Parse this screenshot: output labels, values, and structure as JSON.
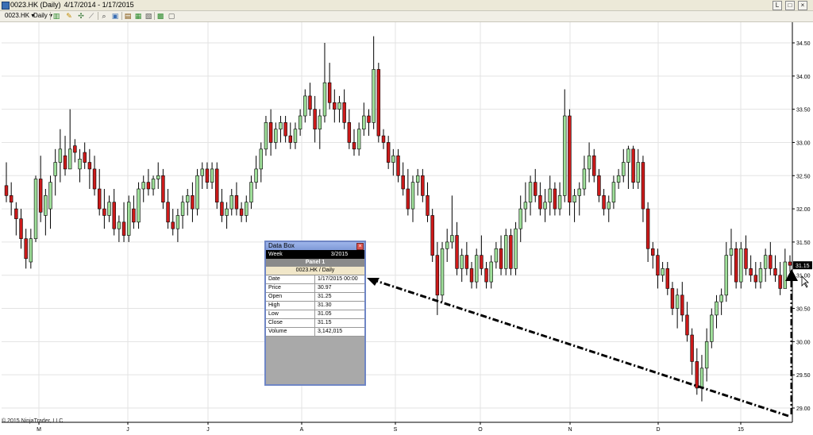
{
  "window": {
    "title_symbol": "0023.HK (Daily)",
    "title_range": "4/17/2014 - 1/17/2015",
    "buttons": [
      "L",
      "□",
      "×"
    ]
  },
  "toolbar": {
    "instrument": "0023.HK",
    "interval": "Daily"
  },
  "colors": {
    "up_candle": "#9fdf9a",
    "down_candle": "#cc1a1a",
    "grid": "#e3e3e3",
    "databox_border": "#6f86c5"
  },
  "chart_data": {
    "type": "candlestick",
    "y_ticks": [
      "34.50",
      "34.00",
      "33.50",
      "33.00",
      "32.50",
      "32.00",
      "31.50",
      "31.00",
      "30.50",
      "30.00",
      "29.50",
      "29.00"
    ],
    "ylim": [
      28.9,
      34.7
    ],
    "x_ticks": [
      "M",
      "J",
      "J",
      "A",
      "S",
      "O",
      "N",
      "D",
      "15"
    ],
    "last_price_label": "31.15",
    "candles": [
      {
        "o": 32.35,
        "h": 32.7,
        "l": 32.1,
        "c": 32.2
      },
      {
        "o": 32.2,
        "h": 32.4,
        "l": 31.9,
        "c": 32.1
      },
      {
        "o": 32.0,
        "h": 32.1,
        "l": 31.6,
        "c": 31.85
      },
      {
        "o": 31.85,
        "h": 32.0,
        "l": 31.4,
        "c": 31.55
      },
      {
        "o": 31.55,
        "h": 31.7,
        "l": 31.1,
        "c": 31.25
      },
      {
        "o": 31.2,
        "h": 31.7,
        "l": 31.1,
        "c": 31.55
      },
      {
        "o": 31.55,
        "h": 32.5,
        "l": 31.5,
        "c": 32.45
      },
      {
        "o": 32.45,
        "h": 32.8,
        "l": 31.8,
        "c": 31.95
      },
      {
        "o": 31.9,
        "h": 32.3,
        "l": 31.6,
        "c": 32.2
      },
      {
        "o": 32.0,
        "h": 32.5,
        "l": 31.7,
        "c": 32.4
      },
      {
        "o": 32.5,
        "h": 32.9,
        "l": 32.2,
        "c": 32.7
      },
      {
        "o": 32.7,
        "h": 33.2,
        "l": 32.4,
        "c": 32.9
      },
      {
        "o": 32.8,
        "h": 33.1,
        "l": 32.5,
        "c": 32.6
      },
      {
        "o": 32.6,
        "h": 33.5,
        "l": 32.6,
        "c": 32.9
      },
      {
        "o": 32.95,
        "h": 33.05,
        "l": 32.7,
        "c": 32.85
      },
      {
        "o": 32.6,
        "h": 32.9,
        "l": 32.4,
        "c": 32.75
      },
      {
        "o": 32.85,
        "h": 33.0,
        "l": 32.6,
        "c": 32.7
      },
      {
        "o": 32.7,
        "h": 32.9,
        "l": 32.3,
        "c": 32.6
      },
      {
        "o": 32.6,
        "h": 32.8,
        "l": 32.2,
        "c": 32.3
      },
      {
        "o": 32.3,
        "h": 32.6,
        "l": 31.9,
        "c": 32.0
      },
      {
        "o": 32.0,
        "h": 32.3,
        "l": 31.7,
        "c": 31.9
      },
      {
        "o": 31.9,
        "h": 32.2,
        "l": 31.8,
        "c": 32.1
      },
      {
        "o": 32.1,
        "h": 32.3,
        "l": 31.6,
        "c": 31.7
      },
      {
        "o": 31.7,
        "h": 31.9,
        "l": 31.5,
        "c": 31.8
      },
      {
        "o": 31.8,
        "h": 32.1,
        "l": 31.5,
        "c": 31.6
      },
      {
        "o": 31.6,
        "h": 32.2,
        "l": 31.5,
        "c": 32.1
      },
      {
        "o": 32.0,
        "h": 32.2,
        "l": 31.7,
        "c": 31.8
      },
      {
        "o": 31.8,
        "h": 32.4,
        "l": 31.7,
        "c": 32.3
      },
      {
        "o": 32.3,
        "h": 32.5,
        "l": 32.1,
        "c": 32.4
      },
      {
        "o": 32.4,
        "h": 32.6,
        "l": 32.2,
        "c": 32.3
      },
      {
        "o": 32.3,
        "h": 32.5,
        "l": 32.2,
        "c": 32.45
      },
      {
        "o": 32.45,
        "h": 32.7,
        "l": 32.3,
        "c": 32.5
      },
      {
        "o": 32.5,
        "h": 32.6,
        "l": 32.0,
        "c": 32.1
      },
      {
        "o": 32.1,
        "h": 32.3,
        "l": 31.7,
        "c": 31.8
      },
      {
        "o": 31.8,
        "h": 32.0,
        "l": 31.6,
        "c": 31.7
      },
      {
        "o": 31.7,
        "h": 32.0,
        "l": 31.5,
        "c": 31.9
      },
      {
        "o": 31.9,
        "h": 32.2,
        "l": 31.7,
        "c": 32.1
      },
      {
        "o": 32.1,
        "h": 32.3,
        "l": 31.9,
        "c": 32.2
      },
      {
        "o": 32.2,
        "h": 32.4,
        "l": 31.8,
        "c": 32.0
      },
      {
        "o": 32.0,
        "h": 32.6,
        "l": 31.9,
        "c": 32.5
      },
      {
        "o": 32.5,
        "h": 32.7,
        "l": 32.3,
        "c": 32.6
      },
      {
        "o": 32.6,
        "h": 32.7,
        "l": 32.3,
        "c": 32.4
      },
      {
        "o": 32.4,
        "h": 32.7,
        "l": 32.3,
        "c": 32.6
      },
      {
        "o": 32.6,
        "h": 32.7,
        "l": 32.0,
        "c": 32.1
      },
      {
        "o": 32.1,
        "h": 32.3,
        "l": 31.8,
        "c": 31.9
      },
      {
        "o": 31.9,
        "h": 32.1,
        "l": 31.7,
        "c": 32.0
      },
      {
        "o": 32.0,
        "h": 32.3,
        "l": 31.9,
        "c": 32.2
      },
      {
        "o": 32.2,
        "h": 32.4,
        "l": 31.9,
        "c": 32.0
      },
      {
        "o": 32.0,
        "h": 32.1,
        "l": 31.8,
        "c": 31.9
      },
      {
        "o": 31.9,
        "h": 32.2,
        "l": 31.8,
        "c": 32.1
      },
      {
        "o": 32.1,
        "h": 32.5,
        "l": 32.0,
        "c": 32.4
      },
      {
        "o": 32.4,
        "h": 32.8,
        "l": 32.3,
        "c": 32.6
      },
      {
        "o": 32.6,
        "h": 33.0,
        "l": 32.4,
        "c": 32.9
      },
      {
        "o": 32.9,
        "h": 33.4,
        "l": 32.8,
        "c": 33.3
      },
      {
        "o": 33.3,
        "h": 33.5,
        "l": 32.8,
        "c": 33.0
      },
      {
        "o": 33.0,
        "h": 33.3,
        "l": 32.9,
        "c": 33.2
      },
      {
        "o": 33.2,
        "h": 33.4,
        "l": 33.0,
        "c": 33.3
      },
      {
        "o": 33.3,
        "h": 33.4,
        "l": 33.0,
        "c": 33.1
      },
      {
        "o": 33.1,
        "h": 33.3,
        "l": 32.9,
        "c": 33.0
      },
      {
        "o": 33.0,
        "h": 33.3,
        "l": 32.9,
        "c": 33.2
      },
      {
        "o": 33.2,
        "h": 33.5,
        "l": 33.1,
        "c": 33.4
      },
      {
        "o": 33.4,
        "h": 33.8,
        "l": 33.3,
        "c": 33.7
      },
      {
        "o": 33.7,
        "h": 33.9,
        "l": 33.4,
        "c": 33.5
      },
      {
        "o": 33.5,
        "h": 33.7,
        "l": 33.0,
        "c": 33.2
      },
      {
        "o": 33.2,
        "h": 33.5,
        "l": 32.9,
        "c": 33.4
      },
      {
        "o": 33.4,
        "h": 34.5,
        "l": 33.3,
        "c": 33.9
      },
      {
        "o": 33.9,
        "h": 34.2,
        "l": 33.5,
        "c": 33.6
      },
      {
        "o": 33.6,
        "h": 33.8,
        "l": 33.3,
        "c": 33.5
      },
      {
        "o": 33.5,
        "h": 33.7,
        "l": 33.3,
        "c": 33.6
      },
      {
        "o": 33.6,
        "h": 33.8,
        "l": 33.2,
        "c": 33.3
      },
      {
        "o": 33.3,
        "h": 33.5,
        "l": 32.9,
        "c": 33.0
      },
      {
        "o": 33.0,
        "h": 33.2,
        "l": 32.8,
        "c": 32.9
      },
      {
        "o": 32.9,
        "h": 33.3,
        "l": 32.8,
        "c": 33.2
      },
      {
        "o": 33.2,
        "h": 33.6,
        "l": 33.1,
        "c": 33.4
      },
      {
        "o": 33.4,
        "h": 33.5,
        "l": 33.1,
        "c": 33.3
      },
      {
        "o": 33.3,
        "h": 34.6,
        "l": 33.2,
        "c": 34.1
      },
      {
        "o": 34.1,
        "h": 34.2,
        "l": 33.0,
        "c": 33.1
      },
      {
        "o": 33.1,
        "h": 33.2,
        "l": 32.9,
        "c": 33.0
      },
      {
        "o": 33.0,
        "h": 33.1,
        "l": 32.6,
        "c": 32.7
      },
      {
        "o": 32.7,
        "h": 32.9,
        "l": 32.5,
        "c": 32.8
      },
      {
        "o": 32.8,
        "h": 32.9,
        "l": 32.4,
        "c": 32.5
      },
      {
        "o": 32.5,
        "h": 32.7,
        "l": 32.2,
        "c": 32.3
      },
      {
        "o": 32.3,
        "h": 32.6,
        "l": 31.9,
        "c": 32.0
      },
      {
        "o": 32.0,
        "h": 32.5,
        "l": 31.8,
        "c": 32.4
      },
      {
        "o": 32.4,
        "h": 32.6,
        "l": 32.2,
        "c": 32.5
      },
      {
        "o": 32.5,
        "h": 32.6,
        "l": 32.1,
        "c": 32.2
      },
      {
        "o": 32.2,
        "h": 32.4,
        "l": 31.8,
        "c": 31.9
      },
      {
        "o": 31.9,
        "h": 32.0,
        "l": 31.2,
        "c": 31.3
      },
      {
        "o": 31.3,
        "h": 31.5,
        "l": 30.4,
        "c": 30.7
      },
      {
        "o": 30.7,
        "h": 31.5,
        "l": 30.6,
        "c": 31.4
      },
      {
        "o": 31.4,
        "h": 31.7,
        "l": 31.2,
        "c": 31.5
      },
      {
        "o": 31.5,
        "h": 32.2,
        "l": 31.4,
        "c": 31.6
      },
      {
        "o": 31.6,
        "h": 31.8,
        "l": 31.0,
        "c": 31.1
      },
      {
        "o": 31.1,
        "h": 31.4,
        "l": 30.9,
        "c": 31.3
      },
      {
        "o": 31.3,
        "h": 31.5,
        "l": 31.0,
        "c": 31.1
      },
      {
        "o": 31.1,
        "h": 31.2,
        "l": 30.8,
        "c": 30.9
      },
      {
        "o": 30.9,
        "h": 31.4,
        "l": 30.8,
        "c": 31.3
      },
      {
        "o": 31.3,
        "h": 31.6,
        "l": 31.0,
        "c": 31.1
      },
      {
        "o": 31.1,
        "h": 31.2,
        "l": 30.8,
        "c": 30.9
      },
      {
        "o": 30.9,
        "h": 31.3,
        "l": 30.8,
        "c": 31.2
      },
      {
        "o": 31.2,
        "h": 31.5,
        "l": 31.1,
        "c": 31.4
      },
      {
        "o": 31.4,
        "h": 31.6,
        "l": 31.0,
        "c": 31.1
      },
      {
        "o": 31.1,
        "h": 31.7,
        "l": 31.0,
        "c": 31.6
      },
      {
        "o": 31.6,
        "h": 31.7,
        "l": 31.0,
        "c": 31.1
      },
      {
        "o": 31.1,
        "h": 31.8,
        "l": 31.0,
        "c": 31.7
      },
      {
        "o": 31.7,
        "h": 32.2,
        "l": 31.5,
        "c": 32.0
      },
      {
        "o": 32.0,
        "h": 32.4,
        "l": 31.8,
        "c": 32.1
      },
      {
        "o": 32.1,
        "h": 32.5,
        "l": 31.9,
        "c": 32.4
      },
      {
        "o": 32.4,
        "h": 32.6,
        "l": 32.1,
        "c": 32.2
      },
      {
        "o": 32.2,
        "h": 32.4,
        "l": 31.9,
        "c": 32.0
      },
      {
        "o": 32.0,
        "h": 32.3,
        "l": 31.8,
        "c": 32.1
      },
      {
        "o": 32.1,
        "h": 32.5,
        "l": 31.9,
        "c": 32.3
      },
      {
        "o": 32.3,
        "h": 32.4,
        "l": 31.9,
        "c": 32.0
      },
      {
        "o": 32.0,
        "h": 32.4,
        "l": 31.9,
        "c": 32.2
      },
      {
        "o": 32.2,
        "h": 33.8,
        "l": 32.1,
        "c": 33.4
      },
      {
        "o": 33.4,
        "h": 33.5,
        "l": 31.9,
        "c": 32.1
      },
      {
        "o": 32.1,
        "h": 32.3,
        "l": 31.8,
        "c": 32.2
      },
      {
        "o": 32.2,
        "h": 32.4,
        "l": 31.9,
        "c": 32.3
      },
      {
        "o": 32.3,
        "h": 32.8,
        "l": 32.2,
        "c": 32.6
      },
      {
        "o": 32.6,
        "h": 33.0,
        "l": 32.4,
        "c": 32.8
      },
      {
        "o": 32.8,
        "h": 32.9,
        "l": 32.4,
        "c": 32.5
      },
      {
        "o": 32.5,
        "h": 32.6,
        "l": 32.1,
        "c": 32.2
      },
      {
        "o": 32.2,
        "h": 32.3,
        "l": 31.9,
        "c": 32.0
      },
      {
        "o": 32.0,
        "h": 32.2,
        "l": 31.8,
        "c": 32.1
      },
      {
        "o": 32.1,
        "h": 32.5,
        "l": 32.0,
        "c": 32.4
      },
      {
        "o": 32.4,
        "h": 32.6,
        "l": 32.3,
        "c": 32.5
      },
      {
        "o": 32.5,
        "h": 32.9,
        "l": 32.4,
        "c": 32.7
      },
      {
        "o": 32.7,
        "h": 32.95,
        "l": 32.3,
        "c": 32.9
      },
      {
        "o": 32.9,
        "h": 32.95,
        "l": 32.3,
        "c": 32.4
      },
      {
        "o": 32.4,
        "h": 32.9,
        "l": 32.3,
        "c": 32.7
      },
      {
        "o": 32.7,
        "h": 32.8,
        "l": 31.8,
        "c": 32.0
      },
      {
        "o": 32.0,
        "h": 32.1,
        "l": 31.2,
        "c": 31.4
      },
      {
        "o": 31.4,
        "h": 31.5,
        "l": 31.1,
        "c": 31.3
      },
      {
        "o": 31.3,
        "h": 31.4,
        "l": 30.8,
        "c": 31.0
      },
      {
        "o": 31.0,
        "h": 31.2,
        "l": 30.9,
        "c": 31.1
      },
      {
        "o": 31.1,
        "h": 31.2,
        "l": 30.7,
        "c": 30.8
      },
      {
        "o": 30.8,
        "h": 30.9,
        "l": 30.4,
        "c": 30.5
      },
      {
        "o": 30.5,
        "h": 30.8,
        "l": 30.2,
        "c": 30.7
      },
      {
        "o": 30.7,
        "h": 30.9,
        "l": 30.3,
        "c": 30.4
      },
      {
        "o": 30.4,
        "h": 30.6,
        "l": 30.0,
        "c": 30.1
      },
      {
        "o": 30.1,
        "h": 30.2,
        "l": 29.5,
        "c": 29.7
      },
      {
        "o": 29.7,
        "h": 29.9,
        "l": 29.2,
        "c": 29.3
      },
      {
        "o": 29.3,
        "h": 29.8,
        "l": 29.1,
        "c": 29.6
      },
      {
        "o": 29.6,
        "h": 30.2,
        "l": 29.4,
        "c": 30.0
      },
      {
        "o": 30.0,
        "h": 30.5,
        "l": 29.9,
        "c": 30.4
      },
      {
        "o": 30.4,
        "h": 30.7,
        "l": 30.2,
        "c": 30.6
      },
      {
        "o": 30.6,
        "h": 30.8,
        "l": 30.4,
        "c": 30.7
      },
      {
        "o": 30.7,
        "h": 31.5,
        "l": 30.6,
        "c": 31.3
      },
      {
        "o": 31.3,
        "h": 31.7,
        "l": 31.0,
        "c": 31.4
      },
      {
        "o": 31.4,
        "h": 31.5,
        "l": 30.8,
        "c": 30.9
      },
      {
        "o": 30.9,
        "h": 31.5,
        "l": 30.8,
        "c": 31.4
      },
      {
        "o": 31.4,
        "h": 31.6,
        "l": 31.0,
        "c": 31.1
      },
      {
        "o": 31.1,
        "h": 31.3,
        "l": 30.9,
        "c": 31.0
      },
      {
        "o": 31.0,
        "h": 31.2,
        "l": 30.8,
        "c": 30.9
      },
      {
        "o": 30.9,
        "h": 31.2,
        "l": 30.8,
        "c": 31.1
      },
      {
        "o": 31.1,
        "h": 31.4,
        "l": 30.9,
        "c": 31.3
      },
      {
        "o": 31.3,
        "h": 31.5,
        "l": 31.0,
        "c": 31.1
      },
      {
        "o": 31.1,
        "h": 31.3,
        "l": 30.9,
        "c": 31.0
      },
      {
        "o": 31.0,
        "h": 31.2,
        "l": 30.7,
        "c": 30.8
      },
      {
        "o": 30.8,
        "h": 31.4,
        "l": 30.8,
        "c": 31.2
      },
      {
        "o": 31.2,
        "h": 31.3,
        "l": 31.05,
        "c": 31.15
      }
    ]
  },
  "databox": {
    "title": "Data Box",
    "week_label": "Week",
    "week_value": "3/2015",
    "panel": "Panel 1",
    "instrument": "0023.HK / Daily",
    "rows": [
      {
        "label": "Date",
        "value": "1/17/2015 00:00"
      },
      {
        "label": "Price",
        "value": "30.97"
      },
      {
        "label": "Open",
        "value": "31.25"
      },
      {
        "label": "High",
        "value": "31.30"
      },
      {
        "label": "Low",
        "value": "31.05"
      },
      {
        "label": "Close",
        "value": "31.15"
      },
      {
        "label": "Volume",
        "value": "3,142,015"
      }
    ]
  },
  "copyright": "© 2015 NinjaTrader, LLC"
}
